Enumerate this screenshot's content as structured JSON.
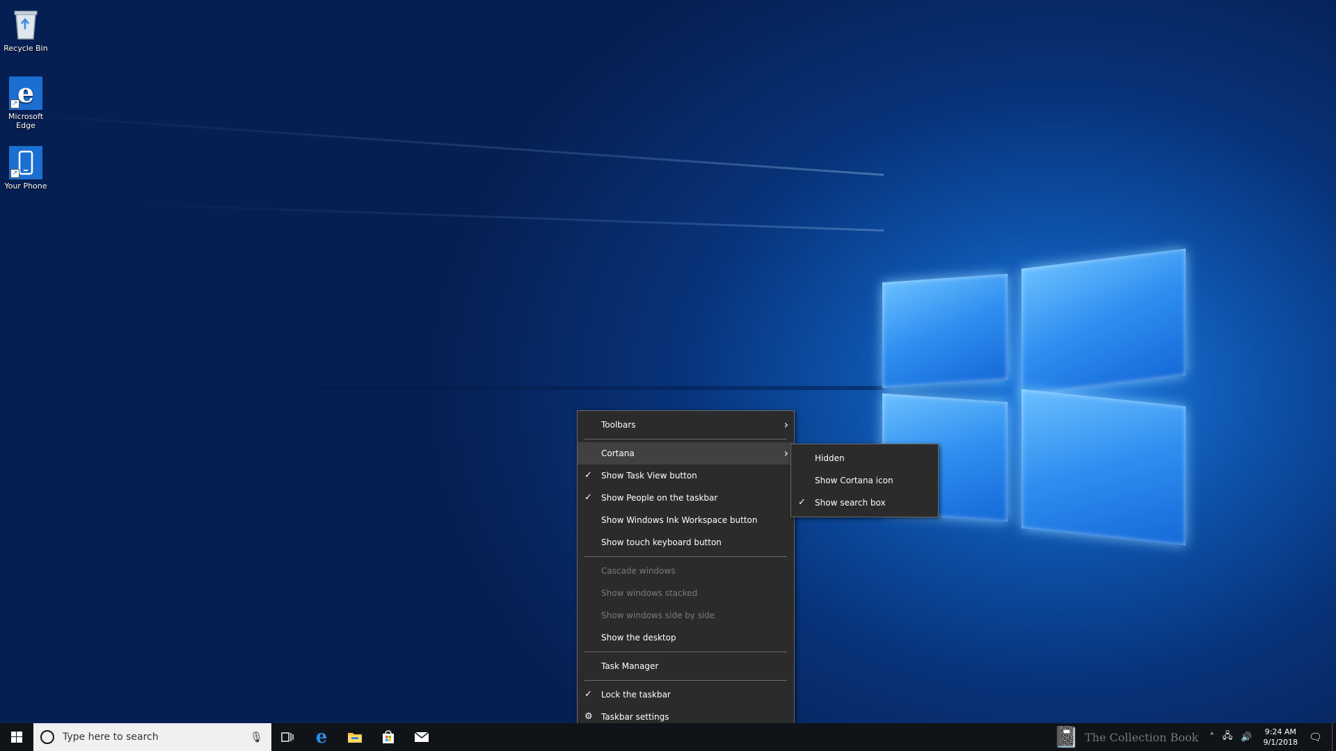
{
  "desktop": {
    "icons": [
      {
        "label": "Recycle Bin"
      },
      {
        "label": "Microsoft Edge"
      },
      {
        "label": "Your Phone"
      }
    ]
  },
  "context_menu": {
    "items": {
      "toolbars": "Toolbars",
      "cortana": "Cortana",
      "show_task_view": "Show Task View button",
      "show_people": "Show People on the taskbar",
      "show_ink": "Show Windows Ink Workspace button",
      "show_touch_keyboard": "Show touch keyboard button",
      "cascade": "Cascade windows",
      "stacked": "Show windows stacked",
      "side_by_side": "Show windows side by side",
      "show_desktop": "Show the desktop",
      "task_manager": "Task Manager",
      "lock_taskbar": "Lock the taskbar",
      "taskbar_settings": "Taskbar settings"
    }
  },
  "cortana_submenu": {
    "hidden": "Hidden",
    "show_icon": "Show Cortana icon",
    "show_search_box": "Show search box"
  },
  "taskbar": {
    "search_placeholder": "Type here to search"
  },
  "tray": {
    "time": "9:24 AM",
    "date": "9/1/2018"
  },
  "watermark": "The Collection Book",
  "colors": {
    "menu_bg": "#2b2b2b",
    "menu_highlight": "#414141",
    "taskbar_bg": "#101418",
    "accent": "#0078d7"
  }
}
